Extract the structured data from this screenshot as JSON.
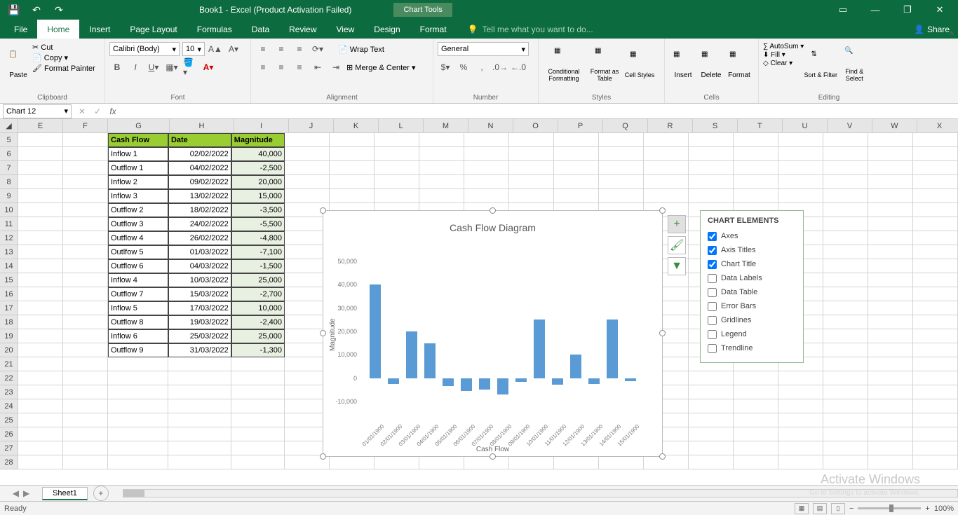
{
  "title": "Book1 - Excel (Product Activation Failed)",
  "chart_tools_tab": "Chart Tools",
  "tabs": {
    "file": "File",
    "home": "Home",
    "insert": "Insert",
    "pagelayout": "Page Layout",
    "formulas": "Formulas",
    "data": "Data",
    "review": "Review",
    "view": "View",
    "design": "Design",
    "format": "Format"
  },
  "tellme": "Tell me what you want to do...",
  "share": "Share",
  "ribbon": {
    "clipboard": {
      "paste": "Paste",
      "cut": "Cut",
      "copy": "Copy",
      "formatpainter": "Format Painter",
      "label": "Clipboard"
    },
    "font": {
      "name": "Calibri (Body)",
      "size": "10",
      "label": "Font"
    },
    "alignment": {
      "wrap": "Wrap Text",
      "merge": "Merge & Center",
      "label": "Alignment"
    },
    "number": {
      "format": "General",
      "label": "Number"
    },
    "styles": {
      "cond": "Conditional Formatting",
      "table": "Format as Table",
      "cellstyles": "Cell Styles",
      "label": "Styles"
    },
    "cells": {
      "insert": "Insert",
      "delete": "Delete",
      "format": "Format",
      "label": "Cells"
    },
    "editing": {
      "autosum": "AutoSum",
      "fill": "Fill",
      "clear": "Clear",
      "sortfilter": "Sort & Filter",
      "findselect": "Find & Select",
      "label": "Editing"
    }
  },
  "namebox": "Chart 12",
  "columns": [
    "E",
    "F",
    "G",
    "H",
    "I",
    "J",
    "K",
    "L",
    "M",
    "N",
    "O",
    "P",
    "Q",
    "R",
    "S",
    "T",
    "U",
    "V",
    "W",
    "X"
  ],
  "rows_visible": [
    5,
    6,
    7,
    8,
    9,
    10,
    11,
    12,
    13,
    14,
    15,
    16,
    17,
    18,
    19,
    20,
    21,
    22,
    23,
    24,
    25,
    26,
    27,
    28
  ],
  "table": {
    "headers": {
      "g": "Cash Flow",
      "h": "Date",
      "i": "Magnitude"
    },
    "rows": [
      {
        "g": "Inflow 1",
        "h": "02/02/2022",
        "i": "40,000"
      },
      {
        "g": "Outflow 1",
        "h": "04/02/2022",
        "i": "-2,500"
      },
      {
        "g": "Inflow 2",
        "h": "09/02/2022",
        "i": "20,000"
      },
      {
        "g": "Inflow 3",
        "h": "13/02/2022",
        "i": "15,000"
      },
      {
        "g": "Outflow 2",
        "h": "18/02/2022",
        "i": "-3,500"
      },
      {
        "g": "Outflow 3",
        "h": "24/02/2022",
        "i": "-5,500"
      },
      {
        "g": "Outflow 4",
        "h": "26/02/2022",
        "i": "-4,800"
      },
      {
        "g": "Outlfow 5",
        "h": "01/03/2022",
        "i": "-7,100"
      },
      {
        "g": "Outflow 6",
        "h": "04/03/2022",
        "i": "-1,500"
      },
      {
        "g": "Inflow 4",
        "h": "10/03/2022",
        "i": "25,000"
      },
      {
        "g": "Outflow 7",
        "h": "15/03/2022",
        "i": "-2,700"
      },
      {
        "g": "Inflow 5",
        "h": "17/03/2022",
        "i": "10,000"
      },
      {
        "g": "Outflow 8",
        "h": "19/03/2022",
        "i": "-2,400"
      },
      {
        "g": "Inflow 6",
        "h": "25/03/2022",
        "i": "25,000"
      },
      {
        "g": "Outflow 9",
        "h": "31/03/2022",
        "i": "-1,300"
      }
    ]
  },
  "chart_data": {
    "type": "bar",
    "title": "Cash Flow Diagram",
    "xlabel": "Cash Flow",
    "ylabel": "Magnitude",
    "ylim": [
      -10000,
      50000
    ],
    "yticks": [
      "-10,000",
      "0",
      "10,000",
      "20,000",
      "30,000",
      "40,000",
      "50,000"
    ],
    "categories": [
      "01/01/1900",
      "02/01/1900",
      "03/01/1900",
      "04/01/1900",
      "05/01/1900",
      "06/01/1900",
      "07/01/1900",
      "08/01/1900",
      "09/01/1900",
      "10/01/1900",
      "11/01/1900",
      "12/01/1900",
      "13/01/1900",
      "14/01/1900",
      "15/01/1900"
    ],
    "values": [
      40000,
      -2500,
      20000,
      15000,
      -3500,
      -5500,
      -4800,
      -7100,
      -1500,
      25000,
      -2700,
      10000,
      -2400,
      25000,
      -1300
    ]
  },
  "chart_elements": {
    "title": "CHART ELEMENTS",
    "items": [
      {
        "label": "Axes",
        "checked": true
      },
      {
        "label": "Axis Titles",
        "checked": true
      },
      {
        "label": "Chart Title",
        "checked": true
      },
      {
        "label": "Data Labels",
        "checked": false
      },
      {
        "label": "Data Table",
        "checked": false
      },
      {
        "label": "Error Bars",
        "checked": false
      },
      {
        "label": "Gridlines",
        "checked": false
      },
      {
        "label": "Legend",
        "checked": false
      },
      {
        "label": "Trendline",
        "checked": false
      }
    ]
  },
  "sheet": "Sheet1",
  "status": "Ready",
  "zoom": "100%",
  "watermark": "Activate Windows",
  "watermark_sub": "Go to Settings to activate Windows."
}
